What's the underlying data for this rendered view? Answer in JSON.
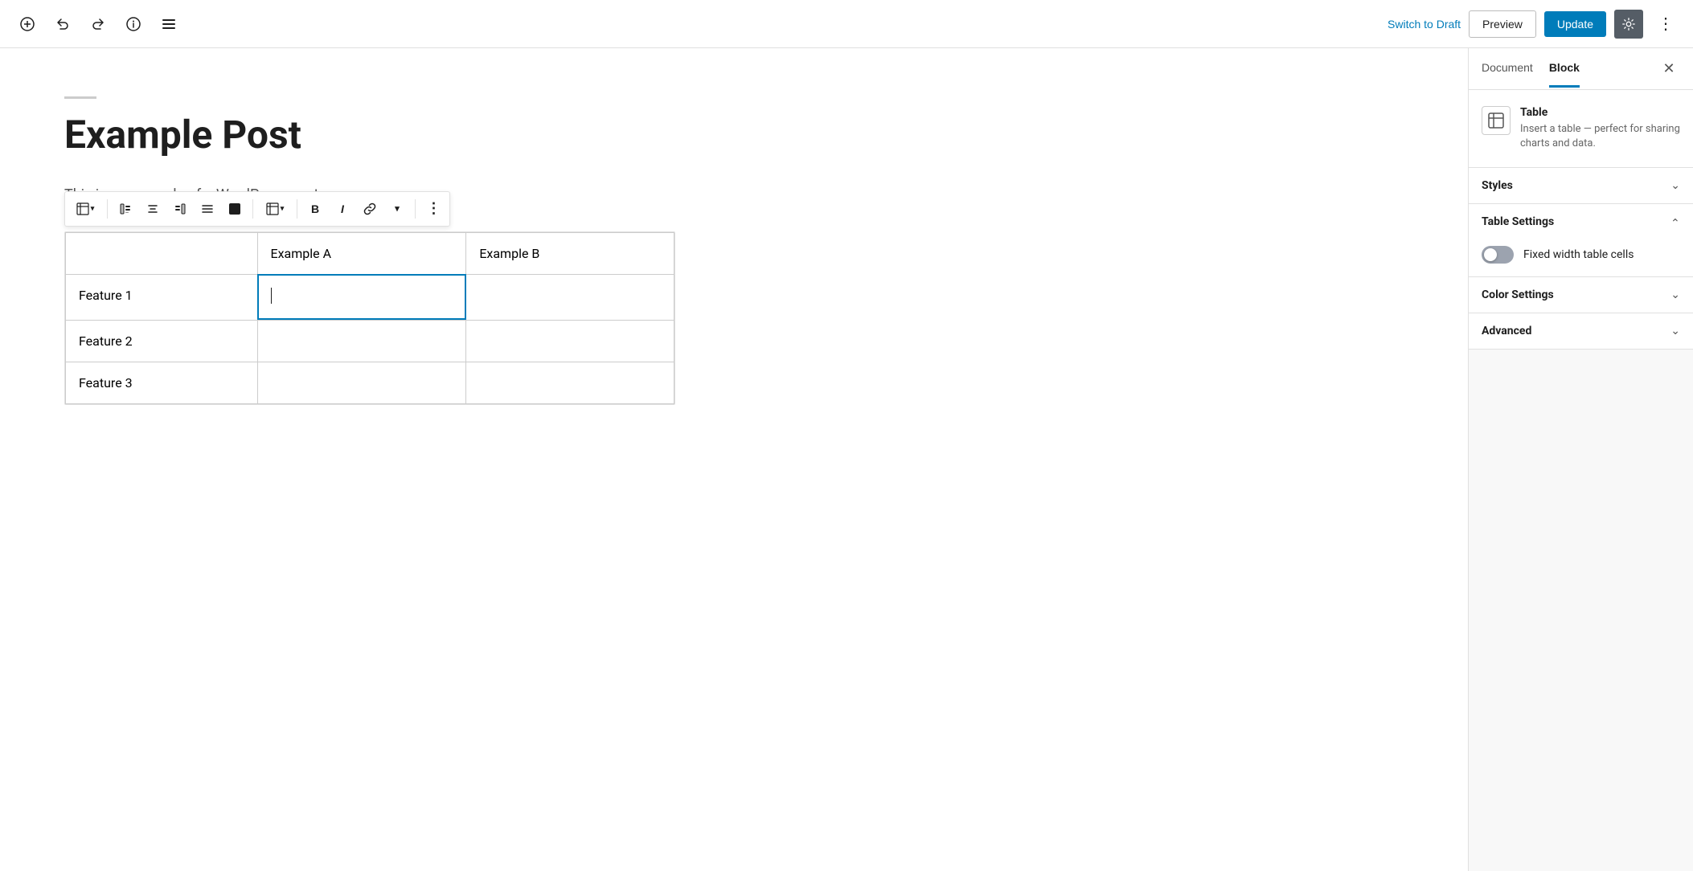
{
  "topbar": {
    "add_label": "+",
    "undo_label": "↩",
    "redo_label": "↪",
    "info_label": "ℹ",
    "list_label": "☰",
    "switch_draft_label": "Switch to Draft",
    "preview_label": "Preview",
    "update_label": "Update",
    "settings_icon": "⚙",
    "more_icon": "⋮"
  },
  "editor": {
    "divider_visible": true,
    "post_title": "Example Post",
    "post_excerpt": "This is an example of a WordPress post"
  },
  "table": {
    "headers": [
      "",
      "Example A",
      "Example B"
    ],
    "rows": [
      [
        "Feature 1",
        "",
        ""
      ],
      [
        "Feature 2",
        "",
        ""
      ],
      [
        "Feature 3",
        "",
        ""
      ]
    ],
    "active_cell": {
      "row": 0,
      "col": 1
    }
  },
  "toolbar": {
    "buttons": [
      {
        "id": "table-type",
        "label": "⊞",
        "has_arrow": true
      },
      {
        "id": "align-left",
        "label": "⬛"
      },
      {
        "id": "align-center",
        "label": "⬛"
      },
      {
        "id": "align-right",
        "label": "⬛"
      },
      {
        "id": "align-full",
        "label": "⬛"
      },
      {
        "id": "background",
        "label": "⬛"
      },
      {
        "id": "table-edit",
        "label": "⊞",
        "has_arrow": true
      },
      {
        "id": "bold",
        "label": "B"
      },
      {
        "id": "italic",
        "label": "I"
      },
      {
        "id": "link",
        "label": "🔗"
      },
      {
        "id": "more-rich",
        "label": "▾"
      },
      {
        "id": "more-options",
        "label": "⋮"
      }
    ]
  },
  "sidebar": {
    "tabs": [
      {
        "id": "document",
        "label": "Document",
        "active": false
      },
      {
        "id": "block",
        "label": "Block",
        "active": true
      }
    ],
    "block_info": {
      "name": "Table",
      "description": "Insert a table — perfect for sharing charts and data."
    },
    "panels": [
      {
        "id": "styles",
        "title": "Styles",
        "expanded": false
      },
      {
        "id": "table-settings",
        "title": "Table Settings",
        "expanded": true,
        "settings": [
          {
            "id": "fixed-width",
            "label": "Fixed width table cells",
            "toggle_on": false
          }
        ]
      },
      {
        "id": "color-settings",
        "title": "Color Settings",
        "expanded": false
      },
      {
        "id": "advanced",
        "title": "Advanced",
        "expanded": false
      }
    ]
  }
}
